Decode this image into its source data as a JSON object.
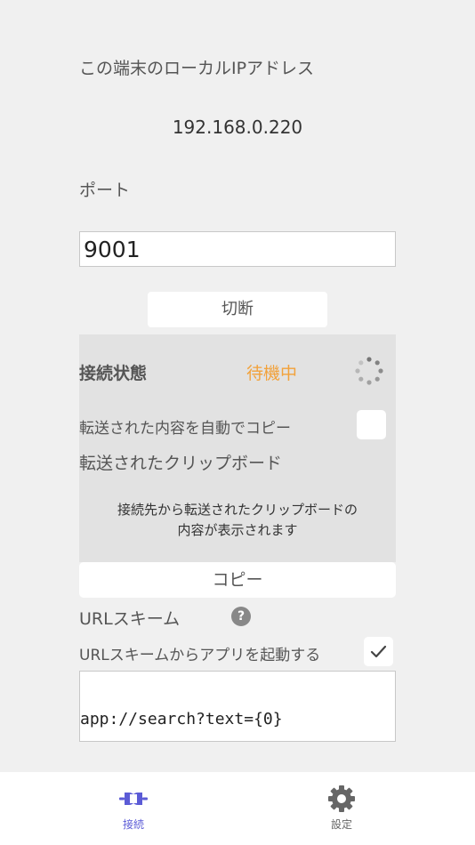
{
  "ip": {
    "label": "この端末のローカルIPアドレス",
    "value": "192.168.0.220"
  },
  "port": {
    "label": "ポート",
    "value": "9001"
  },
  "disconnect_button": "切断",
  "status": {
    "label": "接続状態",
    "value": "待機中",
    "value_color": "#f2a23b"
  },
  "auto_copy": {
    "label": "転送された内容を自動でコピー",
    "checked": false
  },
  "clipboard": {
    "label": "転送されたクリップボード",
    "message_line1": "接続先から転送されたクリップボードの",
    "message_line2": "内容が表示されます"
  },
  "copy_button": "コピー",
  "url_scheme": {
    "label": "URLスキーム",
    "help_icon": "?",
    "launch_label": "URLスキームからアプリを起動する",
    "launch_checked": true,
    "value": "app://search?text={0}"
  },
  "tabs": [
    {
      "label": "接続",
      "icon": "plug-icon",
      "active": true,
      "color": "#5b5bd6"
    },
    {
      "label": "設定",
      "icon": "gear-icon",
      "active": false,
      "color": "#666666"
    }
  ]
}
